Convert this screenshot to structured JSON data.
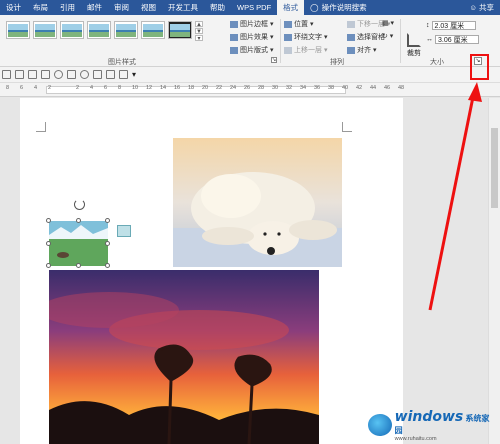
{
  "menubar": {
    "tabs": [
      "设计",
      "布局",
      "引用",
      "邮件",
      "审阅",
      "视图",
      "开发工具",
      "帮助",
      "WPS PDF",
      "格式"
    ],
    "active_tab": "格式",
    "tell_me": "操作说明搜索",
    "share": "共享"
  },
  "ribbon": {
    "picture_styles_label": "图片样式",
    "border": "图片边框",
    "effects": "图片效果",
    "layout": "图片版式",
    "position": "位置",
    "wrap_text": "环绕文字",
    "bring_forward": "上移一层",
    "send_backward": "下移一层",
    "selection_pane": "选择窗格",
    "align": "对齐",
    "arrange_label": "排列",
    "crop": "裁剪",
    "height": "2.03 厘米",
    "width": "3.06 厘米",
    "size_label": "大小",
    "launcher": "↘"
  },
  "ruler": {
    "ticks": [
      "8",
      "6",
      "4",
      "2",
      "",
      "2",
      "4",
      "6",
      "8",
      "10",
      "12",
      "14",
      "16",
      "18",
      "20",
      "22",
      "24",
      "26",
      "28",
      "30",
      "32",
      "34",
      "36",
      "38",
      "40",
      "42",
      "44",
      "46",
      "48"
    ]
  },
  "watermark": {
    "brand": "windows",
    "site": "系统家园",
    "url": "www.ruhaitu.com"
  },
  "colors": {
    "accent": "#2b579a",
    "highlight": "#e11111"
  }
}
